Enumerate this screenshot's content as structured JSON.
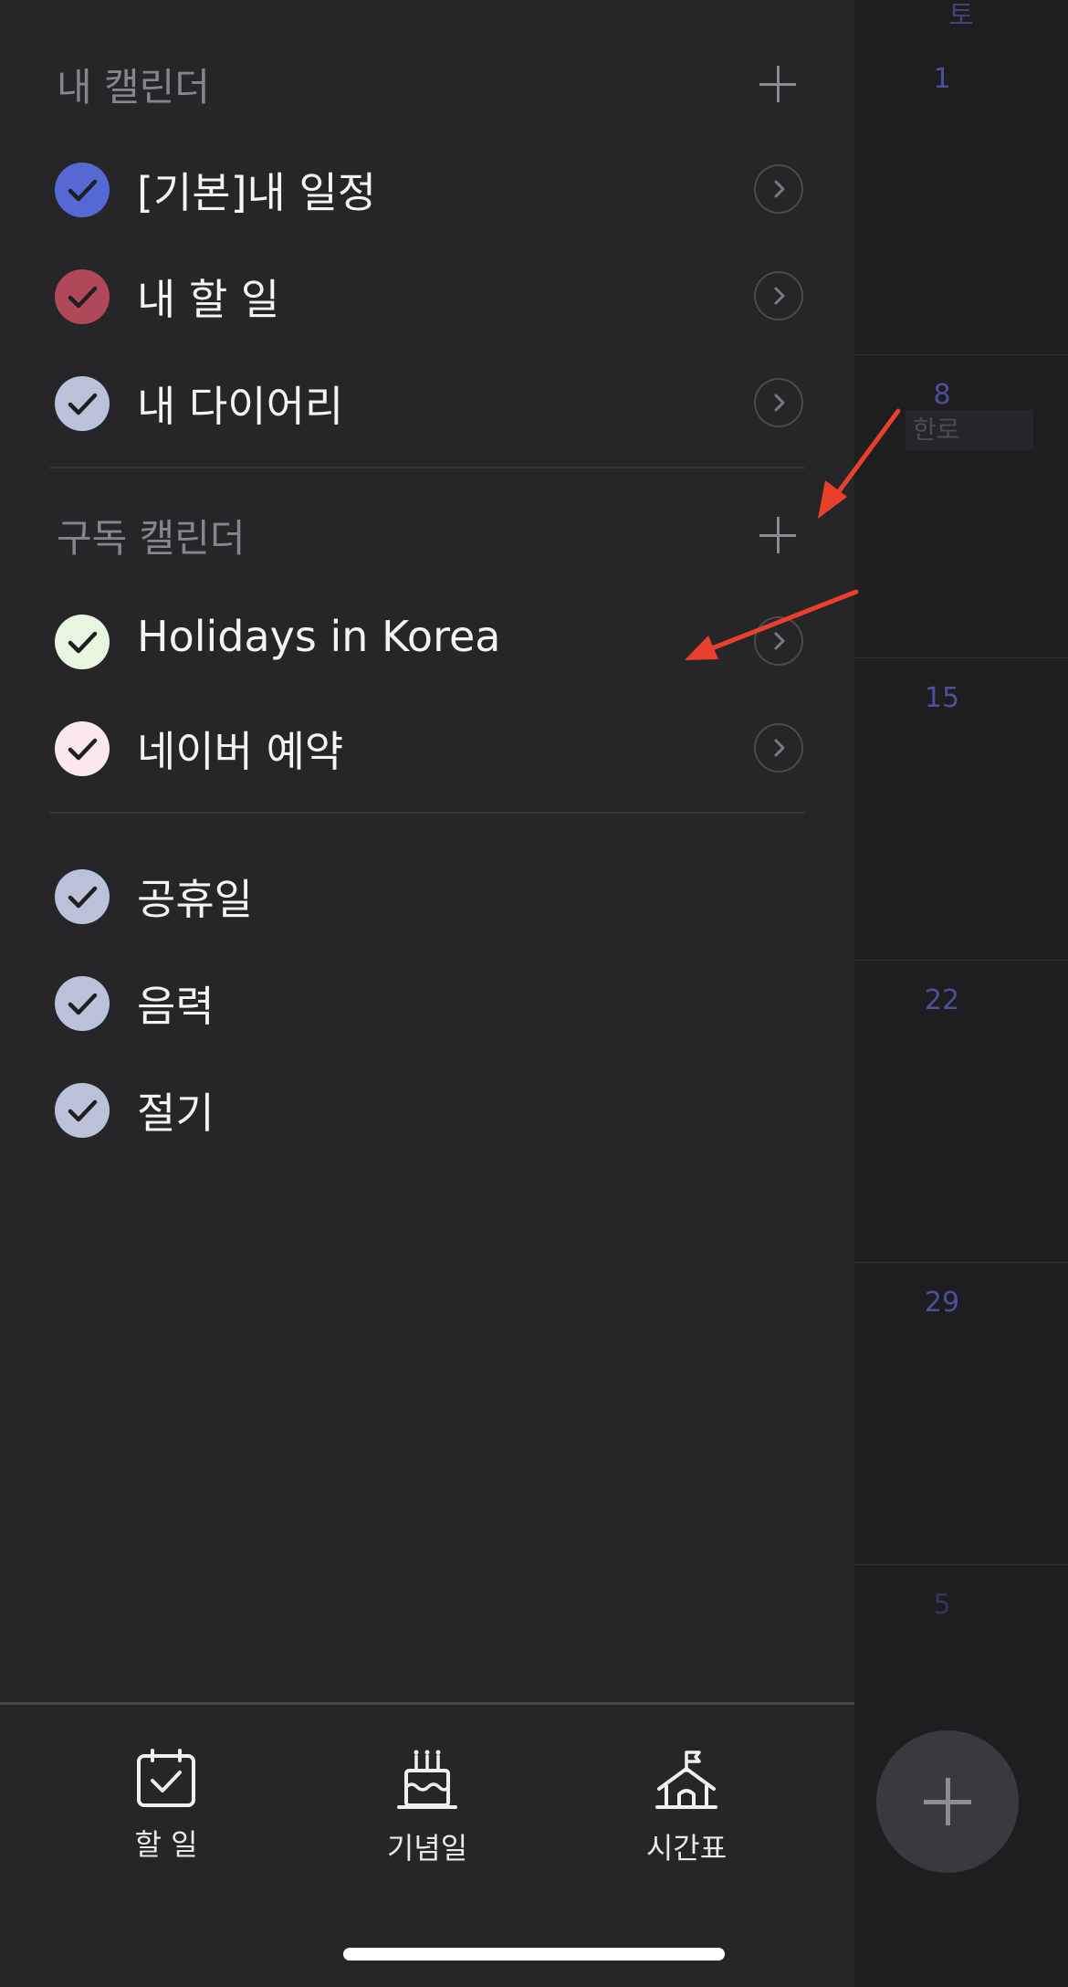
{
  "calendar": {
    "day_header": "토",
    "weeks": [
      {
        "day": "1",
        "event": ""
      },
      {
        "day": "8",
        "event": "한로"
      },
      {
        "day": "15",
        "event": ""
      },
      {
        "day": "22",
        "event": ""
      },
      {
        "day": "29",
        "event": ""
      },
      {
        "day": "5",
        "event": ""
      }
    ]
  },
  "my_calendars": {
    "title": "내 캘린더",
    "items": [
      {
        "label": "[기본]내 일정",
        "color": "#5469d4"
      },
      {
        "label": "내 할 일",
        "color": "#b0485a"
      },
      {
        "label": "내 다이어리",
        "color": "#bcc1da"
      }
    ]
  },
  "subscribed_calendars": {
    "title": "구독 캘린더",
    "items": [
      {
        "label": "Holidays in Korea",
        "color": "#e8f6e0"
      },
      {
        "label": "네이버 예약",
        "color": "#fbe8ec"
      }
    ]
  },
  "other_calendars": {
    "items": [
      {
        "label": "공휴일",
        "color": "#bcc1da"
      },
      {
        "label": "음력",
        "color": "#bcc1da"
      },
      {
        "label": "절기",
        "color": "#bcc1da"
      }
    ]
  },
  "tabbar": {
    "todo_label": "할 일",
    "anniversary_label": "기념일",
    "timetable_label": "시간표"
  },
  "colors": {
    "drawer_bg": "#262629",
    "annotation": "#e8402c"
  }
}
